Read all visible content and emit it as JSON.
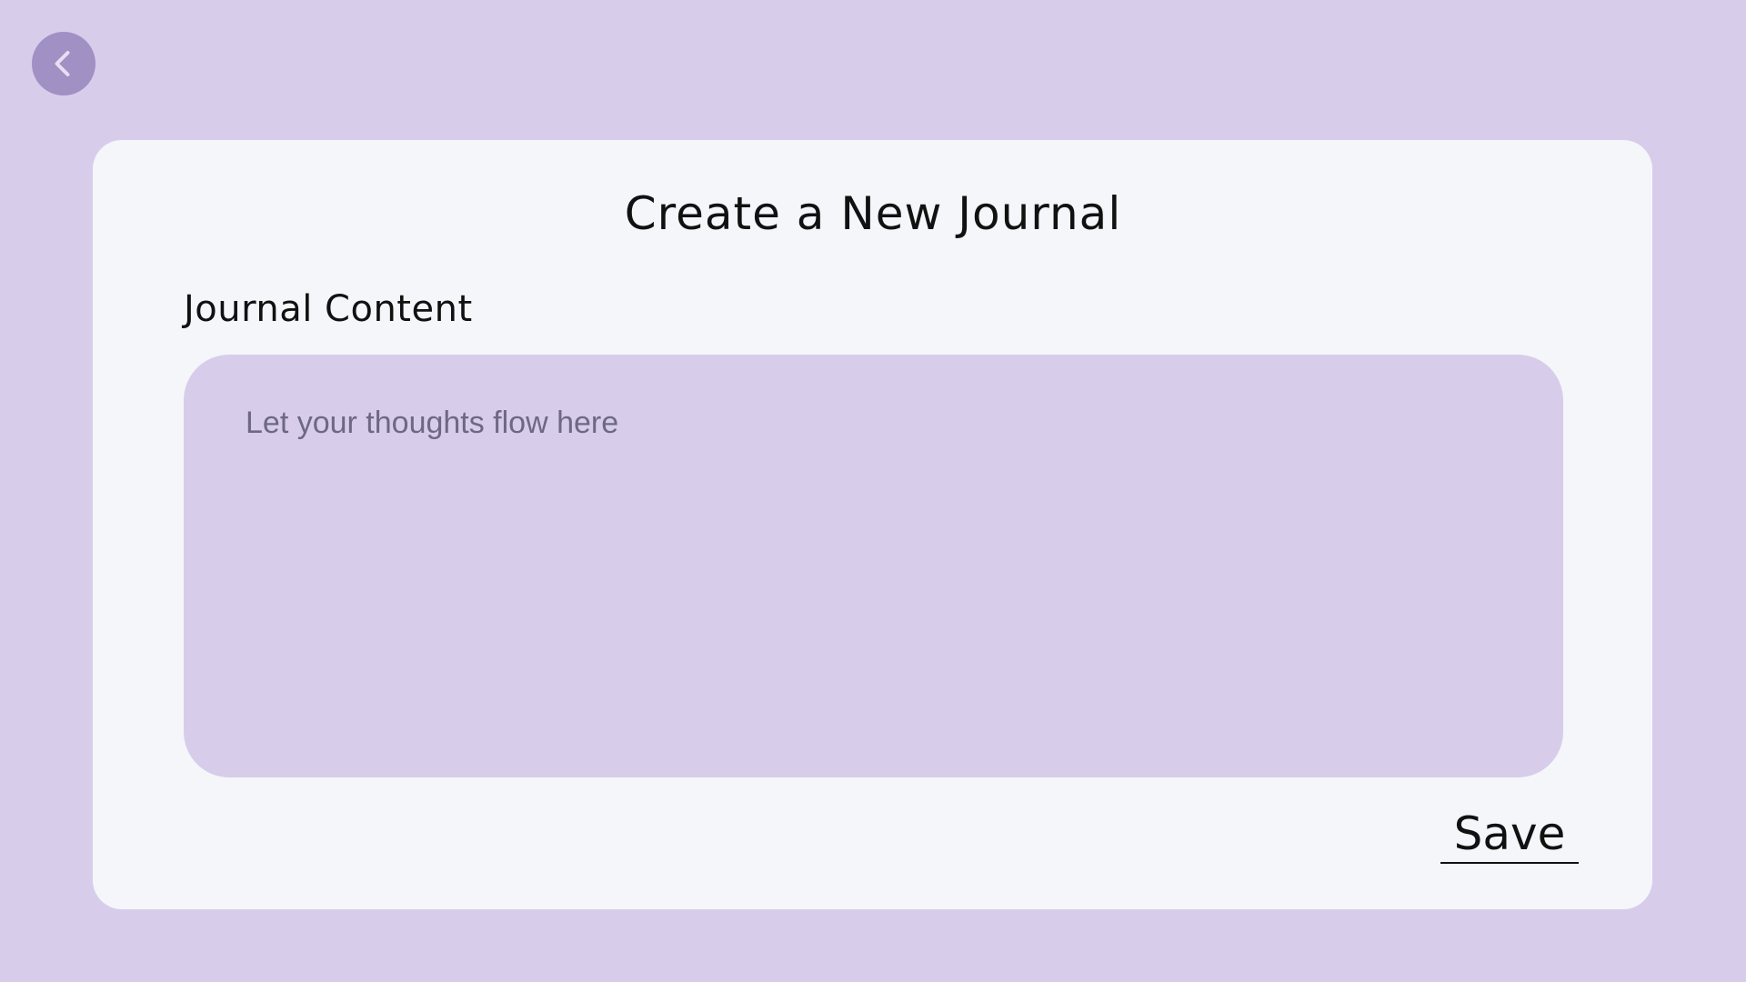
{
  "back_button": {
    "icon": "chevron-left-icon",
    "color": "#a190c4"
  },
  "card": {
    "title": "Create a New Journal",
    "content_label": "Journal Content",
    "content_input": {
      "value": "",
      "placeholder": "Let your thoughts flow here"
    },
    "save_label": "Save"
  },
  "colors": {
    "background": "#d7cdeb",
    "card": "#f5f6fa",
    "accent": "#a190c4",
    "text": "#111111",
    "placeholder": "#6e6882"
  }
}
